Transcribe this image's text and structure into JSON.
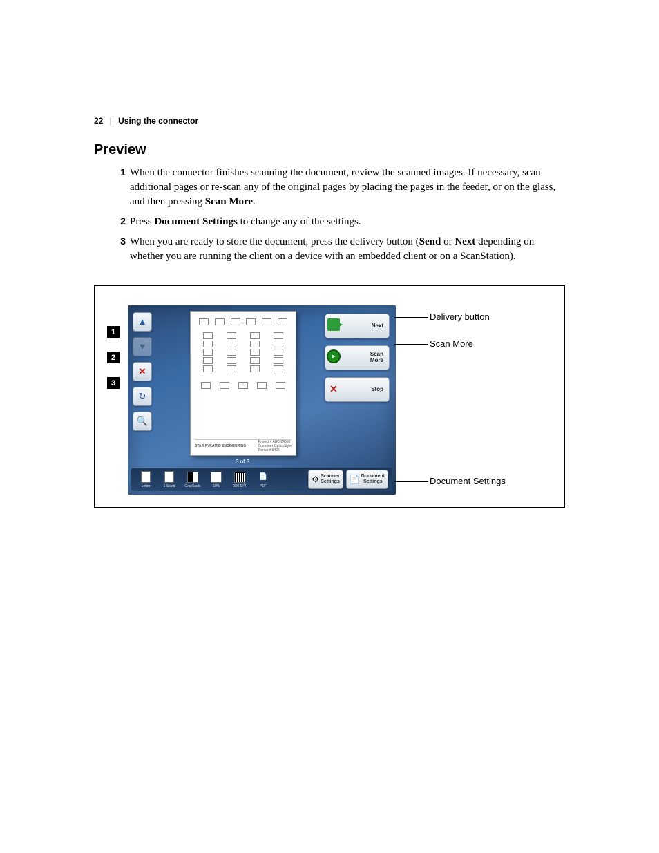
{
  "page_number": "22",
  "header_section": "Using the connector",
  "section_title": "Preview",
  "steps": [
    {
      "num": "1",
      "pre": "When the connector finishes scanning the document, review the scanned images. If necessary, scan additional pages or re-scan any of the original pages by placing the pages in the feeder, or on the glass, and then pressing ",
      "bold": "Scan More",
      "post": "."
    },
    {
      "num": "2",
      "pre": "Press ",
      "bold": "Document Settings",
      "post": " to change any of the settings."
    },
    {
      "num": "3",
      "pre": "When you are ready to store the document, press the delivery button (",
      "bold": "Send",
      "mid": " or ",
      "bold2": "Next",
      "post": " depending on whether you are running the client on a device with an embedded client or on a ScanStation)."
    }
  ],
  "callout_markers": [
    "1",
    "2",
    "3"
  ],
  "device": {
    "page_counter": "3 of 3",
    "doc_footer": {
      "company": "STAR PYRAMID ENGINEERING",
      "field1_label": "Project #",
      "field1_value": "ABC-24356",
      "field2_label": "Customer",
      "field2_value": "OpticsStyle",
      "field3_label": "Rental #",
      "field3_value": "6495"
    },
    "actions": {
      "next": "Next",
      "scan_more": "Scan\nMore",
      "stop": "Stop"
    },
    "status": {
      "letter": "Letter",
      "sided": "1 Sided",
      "grayscale": "GrayScale",
      "scale": "50%",
      "dpi": "300 DPI",
      "format": "PDF"
    },
    "bottom_buttons": {
      "scanner_settings": "Scanner\nSettings",
      "document_settings": "Document\nSettings"
    }
  },
  "callout_labels": {
    "delivery": "Delivery button",
    "scan_more": "Scan More",
    "doc_settings": "Document Settings"
  }
}
